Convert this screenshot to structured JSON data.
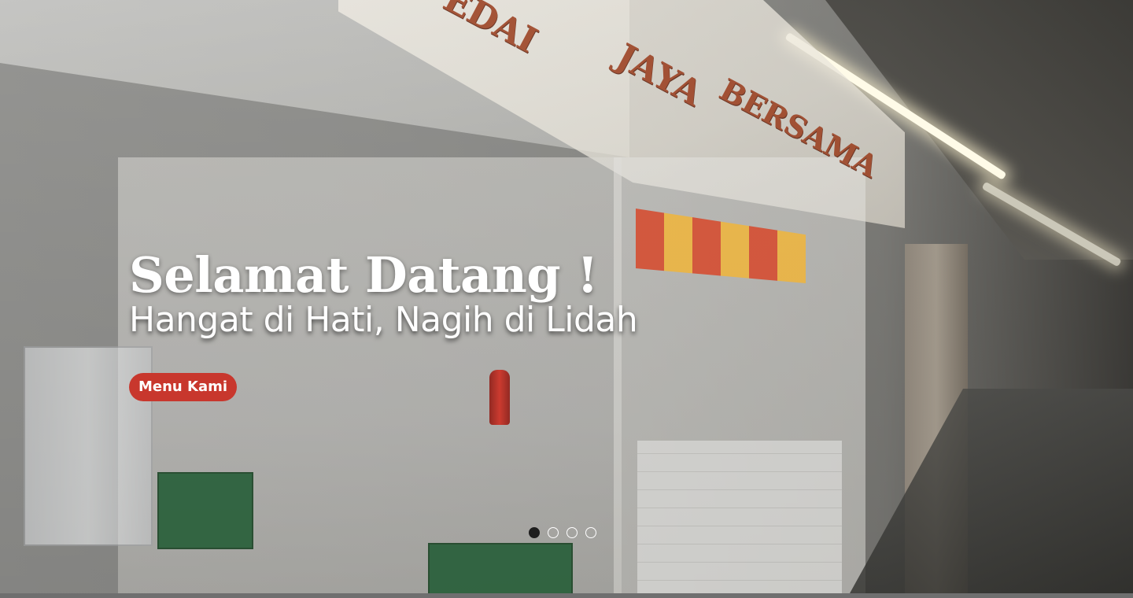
{
  "hero": {
    "title": "Selamat Datang !",
    "subtitle": "Hangat di Hati, Nagih di Lidah",
    "cta_label": "Menu Kami",
    "background_sign_text": "KEDAI JAYA BERSAMA",
    "accent_color": "#c8372d"
  },
  "carousel": {
    "slides": 4,
    "active_index": 0,
    "indicator_labels": [
      "Slide 1",
      "Slide 2",
      "Slide 3",
      "Slide 4"
    ]
  }
}
